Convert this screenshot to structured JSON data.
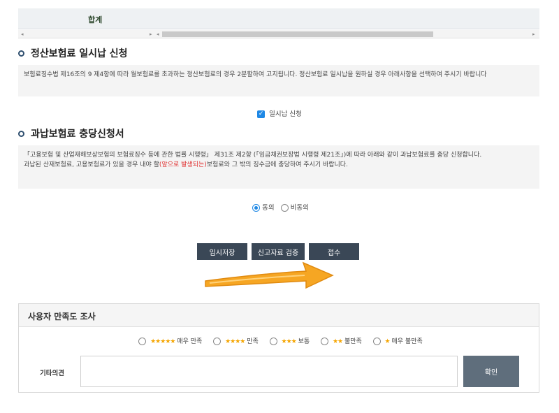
{
  "total_row": {
    "label": "합계"
  },
  "section1": {
    "title": "정산보험료 일시납 신청",
    "notice": "보험료징수법 제16조의 9 제4항에 따라 월보험료를 초과하는 정산보험료의 경우 2분할하여 고지됩니다. 정산보험료 일시납을 원하실 경우 아래사항을 선택하여 주시기 바랍니다",
    "checkbox_label": "일시납 신청"
  },
  "section2": {
    "title": "과납보험료 충당신청서",
    "notice_line1": "「고용보험 및 산업재해보상보험의 보험료징수 등에 관한 법률 시행령」 제31조 제2항 (「임금채권보장법 시행령 제21조」)에 따라 아래와 같이 과납보험료를 충당 신청합니다.",
    "notice_line2_pre": "과납된 산재보험료, 고용보험료가 있을 경우 내야 할",
    "notice_line2_red": "(앞으로 발생되는)",
    "notice_line2_post": "보험료와 그 밖의 징수금에 충당하여 주시기 바랍니다.",
    "radio_agree": "동의",
    "radio_disagree": "비동의"
  },
  "buttons": {
    "temp_save": "임시저장",
    "verify": "신고자료 검증",
    "submit": "접수"
  },
  "survey": {
    "title": "사용자 만족도 조사",
    "options": [
      {
        "stars": "★★★★★",
        "label": "매우 만족"
      },
      {
        "stars": "★★★★",
        "label": "만족"
      },
      {
        "stars": "★★★",
        "label": "보통"
      },
      {
        "stars": "★★",
        "label": "불만족"
      },
      {
        "stars": "★",
        "label": "매우 불만족"
      }
    ],
    "etc_label": "기타의견",
    "confirm": "확인"
  },
  "colors": {
    "accent": "#1e88e5",
    "button_dark": "#3a4756",
    "star": "#f5a500",
    "arrow": "#f6a623"
  }
}
